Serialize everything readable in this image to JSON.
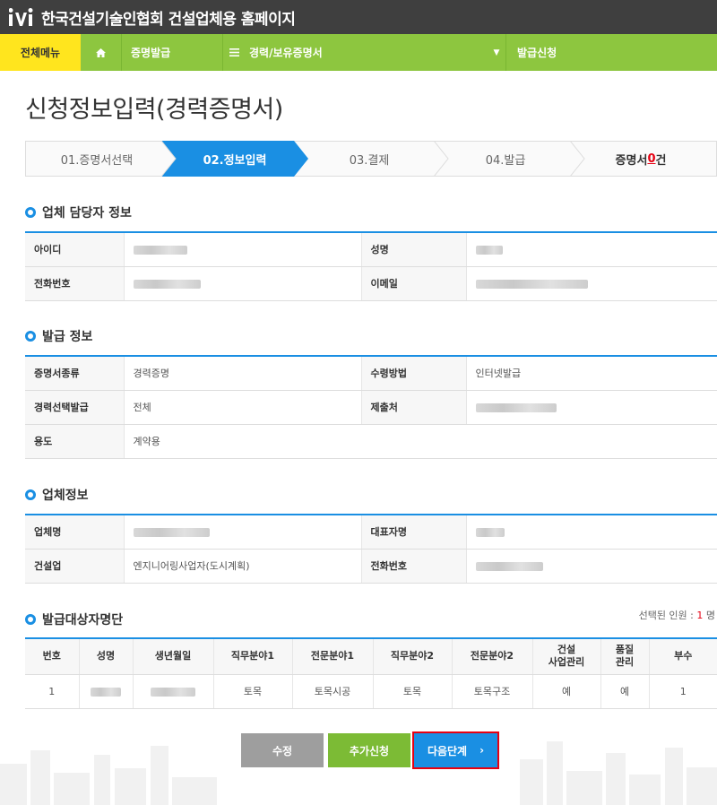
{
  "header": {
    "site_title": "한국건설기술인협회 건설업체용 홈페이지",
    "logo_icon": "kocea-logo"
  },
  "nav": {
    "all_menu": "전체메뉴",
    "home_icon": "home-icon",
    "issue": "증명발급",
    "menu_icon": "hamburger-icon",
    "career": "경력/보유증명서",
    "dropdown_icon": "caret-down-icon",
    "apply": "발급신청"
  },
  "page": {
    "title": "신청정보입력(경력증명서)"
  },
  "steps": {
    "s1": "01.증명서선택",
    "s2": "02.정보입력",
    "s3": "03.결제",
    "s4": "04.발급",
    "count_prefix": "증명서 ",
    "count_num": "0",
    "count_suffix": "건",
    "active_color": "#1a8fe3"
  },
  "contact_section": {
    "title": "업체 담당자 정보",
    "id_label": "아이디",
    "name_label": "성명",
    "phone_label": "전화번호",
    "email_label": "이메일"
  },
  "issue_section": {
    "title": "발급 정보",
    "type_label": "증명서종류",
    "type_value": "경력증명",
    "receive_label": "수령방법",
    "receive_value": "인터넷발급",
    "select_label": "경력선택발급",
    "select_value": "전체",
    "submit_label": "제출처",
    "purpose_label": "용도",
    "purpose_value": "계약용"
  },
  "company_section": {
    "title": "업체정보",
    "company_label": "업체명",
    "ceo_label": "대표자명",
    "industry_label": "건설업",
    "industry_value": "엔지니어링사업자(도시계획)",
    "phone_label": "전화번호"
  },
  "target_section": {
    "title": "발급대상자명단",
    "selected_prefix": "선택된 인원 : ",
    "selected_num": "1",
    "selected_suffix": " 명",
    "headers": {
      "no": "번호",
      "name": "성명",
      "birth": "생년월일",
      "job1": "직무분야1",
      "spec1": "전문분야1",
      "job2": "직무분야2",
      "spec2": "전문분야2",
      "mgmt_1": "건설",
      "mgmt_2": "사업관리",
      "quality_1": "품질",
      "quality_2": "관리",
      "copies": "부수"
    },
    "rows": [
      {
        "no": "1",
        "job1": "토목",
        "spec1": "토목시공",
        "job2": "토목",
        "spec2": "토목구조",
        "mgmt": "예",
        "quality": "예",
        "copies": "1"
      }
    ]
  },
  "buttons": {
    "edit": "수정",
    "add": "추가신청",
    "next": "다음단계",
    "next_icon": "chevron-right-icon"
  },
  "colors": {
    "accent_blue": "#1a8fe3",
    "nav_green": "#8dc63f",
    "nav_yellow": "#ffe51e",
    "highlight_red": "#e60012"
  }
}
